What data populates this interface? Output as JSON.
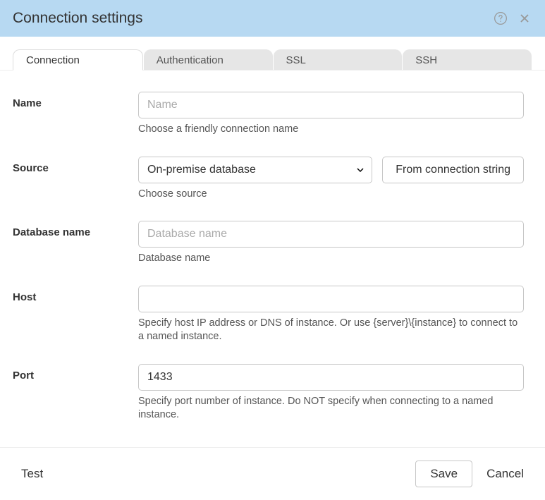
{
  "header": {
    "title": "Connection settings"
  },
  "tabs": [
    {
      "label": "Connection",
      "active": true
    },
    {
      "label": "Authentication",
      "active": false
    },
    {
      "label": "SSL",
      "active": false
    },
    {
      "label": "SSH",
      "active": false
    }
  ],
  "form": {
    "name": {
      "label": "Name",
      "placeholder": "Name",
      "value": "",
      "helper": "Choose a friendly connection name"
    },
    "source": {
      "label": "Source",
      "selected": "On-premise database",
      "from_connection_button": "From connection string",
      "helper": "Choose source"
    },
    "database_name": {
      "label": "Database name",
      "placeholder": "Database name",
      "value": "",
      "helper": "Database name"
    },
    "host": {
      "label": "Host",
      "placeholder": "",
      "value": "",
      "helper": "Specify host IP address or DNS of instance. Or use {server}\\{instance} to connect to a named instance."
    },
    "port": {
      "label": "Port",
      "placeholder": "",
      "value": "1433",
      "helper": "Specify port number of instance. Do NOT specify when connecting to a named instance."
    }
  },
  "footer": {
    "test": "Test",
    "save": "Save",
    "cancel": "Cancel"
  }
}
